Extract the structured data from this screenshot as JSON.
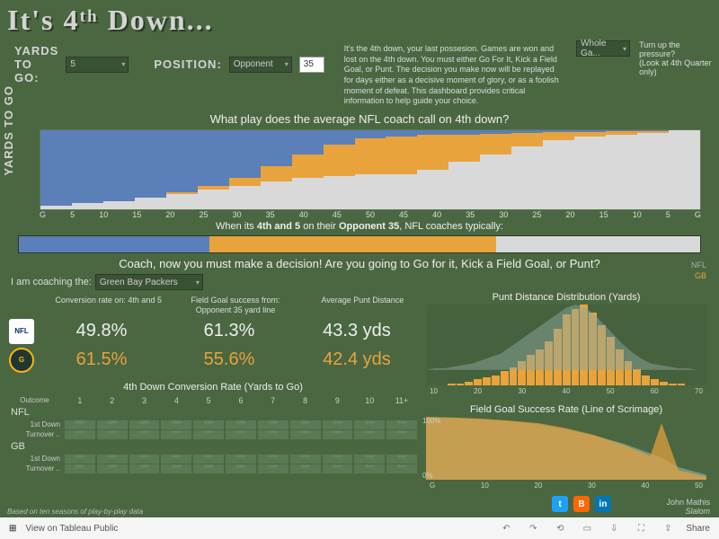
{
  "title_html": "It's 4ᵗʰ Down...",
  "intro": "It's the 4th down, your last possesion. Games are won and lost on the 4th down. You must either Go For It, Kick a Field Goal, or Punt. The decision you make now will be replayed for days either as a decisive moment of glory, or as a foolish moment of defeat. This dashboard provides critical information to help guide your choice.",
  "controls": {
    "yards_label": "YARDS TO GO:",
    "yards_value": "5",
    "position_label": "POSITION:",
    "position_side": "Opponent",
    "position_yard": "35",
    "time_label": "Whole Ga..."
  },
  "pressure": {
    "line1": "Turn up the pressure?",
    "line2": "(Look at 4th Quarter only)"
  },
  "yaxis_label": "YARDS TO GO",
  "section1_title": "What play does the average NFL coach call on 4th down?",
  "summary_text_html": "When its <b>4th and 5</b> on their <b>Opponent 35</b>, NFL coaches typically:",
  "decision_text": "Coach, now you must make a decision! Are you going to Go for it, Kick a Field Goal, or Punt?",
  "coaching_label": "I am coaching the:",
  "team_select": "Green Bay Packers",
  "stats": {
    "headers": {
      "conv": "Conversion rate on: 4th and 5",
      "fg": "Field Goal success from: Opponent 35 yard line",
      "punt": "Average Punt Distance"
    },
    "nfl": {
      "conv": "49.8%",
      "fg": "61.3%",
      "punt": "43.3 yds"
    },
    "gb": {
      "conv": "61.5%",
      "fg": "55.6%",
      "punt": "42.4 yds"
    }
  },
  "conv_table": {
    "title": "4th Down Conversion Rate (Yards to Go)",
    "cols": [
      "1",
      "2",
      "3",
      "4",
      "5",
      "6",
      "7",
      "8",
      "9",
      "10",
      "11+"
    ],
    "outcome_label": "Outcome",
    "rows": [
      "1st Down",
      "Turnover .."
    ],
    "leagues": [
      "NFL",
      "GB"
    ]
  },
  "punt_chart_title": "Punt Distance Distribution (Yards)",
  "fg_chart_title": "Field Goal Success Rate (Line of Scrimage)",
  "legend": {
    "nfl": "NFL",
    "gb": "GB"
  },
  "note": "Based on ten seasons of play-by-play data",
  "credit": {
    "name": "John Mathis",
    "org": "Slalom"
  },
  "footer": {
    "view": "View on Tableau Public",
    "share": "Share"
  },
  "chart_data": {
    "summary_bar": {
      "type": "bar",
      "categories": [
        "Go For It",
        "Field Goal",
        "Punt"
      ],
      "values": [
        28,
        42,
        30
      ],
      "colors": [
        "#5b7fb8",
        "#e8a33d",
        "#d9d9d9"
      ]
    },
    "stacked_field": {
      "type": "bar",
      "note": "stacked 100% bars across field position; proportions estimated",
      "x": [
        "G",
        "5",
        "10",
        "15",
        "20",
        "25",
        "30",
        "35",
        "40",
        "45",
        "50",
        "45",
        "40",
        "35",
        "30",
        "25",
        "20",
        "15",
        "10",
        "5",
        "G"
      ],
      "series": [
        {
          "name": "Go For It",
          "color": "#5b7fb8"
        },
        {
          "name": "Field Goal",
          "color": "#e8a33d"
        },
        {
          "name": "Punt",
          "color": "#d9d9d9"
        }
      ],
      "stacks": [
        [
          95,
          0,
          5
        ],
        [
          92,
          0,
          8
        ],
        [
          90,
          0,
          10
        ],
        [
          85,
          0,
          15
        ],
        [
          78,
          2,
          20
        ],
        [
          70,
          5,
          25
        ],
        [
          60,
          10,
          30
        ],
        [
          45,
          20,
          35
        ],
        [
          30,
          30,
          40
        ],
        [
          18,
          40,
          42
        ],
        [
          10,
          45,
          45
        ],
        [
          8,
          47,
          45
        ],
        [
          6,
          44,
          50
        ],
        [
          5,
          35,
          60
        ],
        [
          4,
          26,
          70
        ],
        [
          3,
          17,
          80
        ],
        [
          2,
          10,
          88
        ],
        [
          2,
          6,
          92
        ],
        [
          1,
          4,
          95
        ],
        [
          1,
          2,
          97
        ],
        [
          0,
          0,
          100
        ]
      ]
    },
    "punt_dist": {
      "type": "bar",
      "xlabel": "Yards",
      "x_ticks": [
        10,
        20,
        30,
        40,
        50,
        60,
        70
      ],
      "categories": [
        10,
        12,
        14,
        16,
        18,
        20,
        22,
        24,
        26,
        28,
        30,
        32,
        34,
        36,
        38,
        40,
        42,
        44,
        46,
        48,
        50,
        52,
        54,
        56,
        58,
        60,
        62,
        64,
        66,
        68,
        70
      ],
      "series": [
        {
          "name": "GB",
          "color": "#e8a33d",
          "values": [
            0,
            0,
            1,
            1,
            2,
            3,
            4,
            5,
            7,
            9,
            12,
            15,
            18,
            22,
            28,
            35,
            38,
            40,
            36,
            30,
            24,
            18,
            12,
            8,
            5,
            3,
            2,
            1,
            1,
            0,
            0
          ]
        },
        {
          "name": "NFL",
          "color": "#8aa89e",
          "values": [
            0,
            1,
            1,
            2,
            3,
            4,
            6,
            8,
            10,
            14,
            18,
            22,
            26,
            30,
            34,
            38,
            40,
            38,
            34,
            28,
            22,
            16,
            11,
            7,
            4,
            3,
            2,
            1,
            1,
            0,
            0
          ]
        }
      ]
    },
    "fg_rate": {
      "type": "area",
      "xlabel": "Line of Scrimmage",
      "ylabel": "%",
      "ylim": [
        0,
        100
      ],
      "y_ticks": [
        "100%",
        "0%"
      ],
      "x_ticks": [
        "G",
        "10",
        "20",
        "30",
        "40",
        "50"
      ],
      "x": [
        0,
        5,
        10,
        15,
        20,
        25,
        30,
        35,
        40,
        42,
        45,
        50
      ],
      "series": [
        {
          "name": "NFL",
          "color": "#8aa89e",
          "values": [
            99,
            98,
            96,
            93,
            88,
            80,
            70,
            58,
            42,
            35,
            20,
            8
          ]
        },
        {
          "name": "GB",
          "color": "#e8a33d",
          "values": [
            100,
            99,
            97,
            94,
            90,
            82,
            71,
            56,
            38,
            90,
            15,
            5
          ]
        }
      ]
    }
  }
}
